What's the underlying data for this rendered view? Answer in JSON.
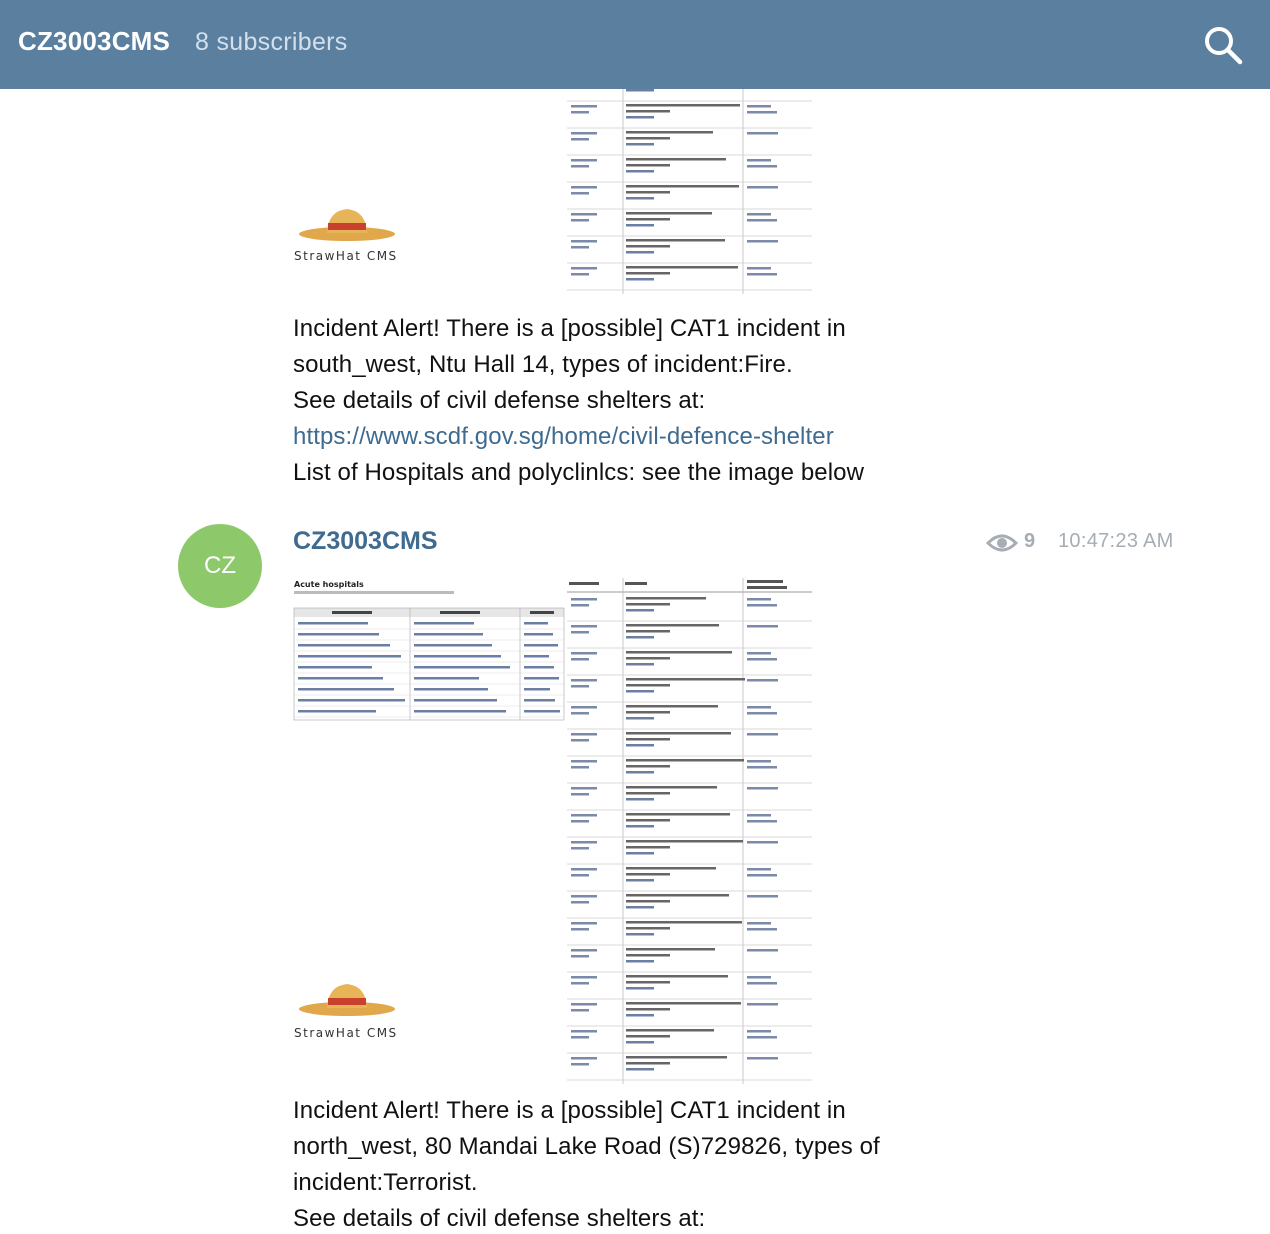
{
  "header": {
    "channel_name": "CZ3003CMS",
    "subscribers": "8 subscribers",
    "search_icon": "search-icon"
  },
  "messages": [
    {
      "image": {
        "logo_text": "StrawHat CMS",
        "description_icon": "straw-hat-logo"
      },
      "text_lines": [
        "Incident Alert! There is a [possible] CAT1 incident in",
        "south_west, Ntu Hall 14, types of incident:Fire.",
        "See details of civil defense shelters at:"
      ],
      "link": "https://www.scdf.gov.sg/home/civil-defence-shelter",
      "text_after_link": "List of Hospitals and polyclinlcs: see the image below"
    },
    {
      "avatar_initials": "CZ",
      "avatar_color": "#8dc96b",
      "author": "CZ3003CMS",
      "views": "9",
      "time": "10:47:23 AM",
      "image": {
        "logo_text": "StrawHat CMS",
        "acute_title": "Acute hospitals",
        "acute_columns": [
          "Acute hospital",
          "Healthcare cluster",
          "Location"
        ]
      },
      "text_lines": [
        "Incident Alert! There is a [possible] CAT1 incident in",
        "north_west, 80 Mandai Lake Road (S)729826, types of",
        "incident:Terrorist.",
        "See details of civil defense shelters at:"
      ]
    }
  ]
}
